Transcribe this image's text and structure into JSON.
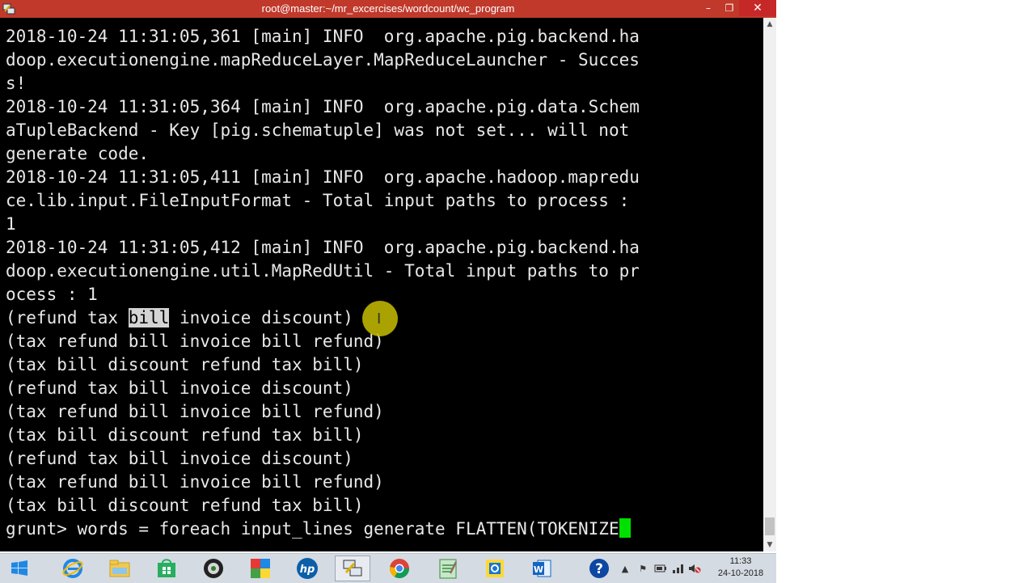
{
  "window": {
    "title": "root@master:~/mr_excercises/wordcount/wc_program",
    "minimize_glyph": "–",
    "maximize_glyph": "❐",
    "close_glyph": "✕"
  },
  "terminal": {
    "background": "#000000",
    "foreground": "#e8e8e8",
    "lines": [
      "2018-10-24 11:31:05,361 [main] INFO  org.apache.pig.backend.ha",
      "doop.executionengine.mapReduceLayer.MapReduceLauncher - Succes",
      "s!",
      "2018-10-24 11:31:05,364 [main] INFO  org.apache.pig.data.Schem",
      "aTupleBackend - Key [pig.schematuple] was not set... will not",
      "generate code.",
      "2018-10-24 11:31:05,411 [main] INFO  org.apache.hadoop.mapredu",
      "ce.lib.input.FileInputFormat - Total input paths to process :",
      "1",
      "2018-10-24 11:31:05,412 [main] INFO  org.apache.pig.backend.ha",
      "doop.executionengine.util.MapRedUtil - Total input paths to pr",
      "ocess : 1"
    ],
    "selected_line": {
      "before": "(refund tax ",
      "selected": "bill",
      "after": " invoice discount)"
    },
    "output_lines": [
      "(tax refund bill invoice bill refund)",
      "(tax bill discount refund tax bill)",
      "(refund tax bill invoice discount)",
      "(tax refund bill invoice bill refund)",
      "(tax bill discount refund tax bill)",
      "(refund tax bill invoice discount)",
      "(tax refund bill invoice bill refund)",
      "(tax bill discount refund tax bill)"
    ],
    "prompt": "grunt> words = foreach input_lines generate FLATTEN(TOKENIZE",
    "cursor_color": "#00e000"
  },
  "taskbar": {
    "items": [
      {
        "name": "windows-start-icon"
      },
      {
        "name": "internet-explorer-icon"
      },
      {
        "name": "file-explorer-icon"
      },
      {
        "name": "store-icon"
      },
      {
        "name": "media-app-icon"
      },
      {
        "name": "puzzle-app-icon"
      },
      {
        "name": "hp-icon"
      },
      {
        "name": "network-tool-icon"
      },
      {
        "name": "chrome-icon"
      },
      {
        "name": "notepad-icon"
      },
      {
        "name": "outlook-icon"
      },
      {
        "name": "word-icon"
      }
    ],
    "help_glyph": "?",
    "clock_time": "11:33",
    "clock_date": "24-10-2018"
  }
}
